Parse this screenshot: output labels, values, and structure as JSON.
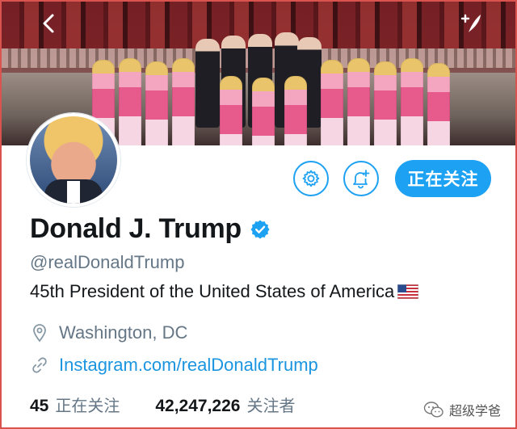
{
  "header": {
    "back_icon": "back-arrow-icon",
    "compose_icon": "compose-icon",
    "banner_image": "group photo in front of palace with costumed performers"
  },
  "profile": {
    "display_name": "Donald J. Trump",
    "verified": true,
    "handle": "@realDonaldTrump",
    "bio": "45th President of the United States of America",
    "bio_emoji": "us-flag",
    "location": "Washington, DC",
    "link": "Instagram.com/realDonaldTrump"
  },
  "actions": {
    "settings_icon": "gear-icon",
    "notify_icon": "bell-plus-icon",
    "follow_label": "正在关注"
  },
  "stats": {
    "following_count": "45",
    "following_label": "正在关注",
    "followers_count": "42,247,226",
    "followers_label": "关注者"
  },
  "watermark": {
    "text": "超级学爸"
  },
  "colors": {
    "accent": "#1da1f2",
    "link": "#1b95e0",
    "secondary_text": "#657786",
    "frame_border": "#d9534f"
  }
}
